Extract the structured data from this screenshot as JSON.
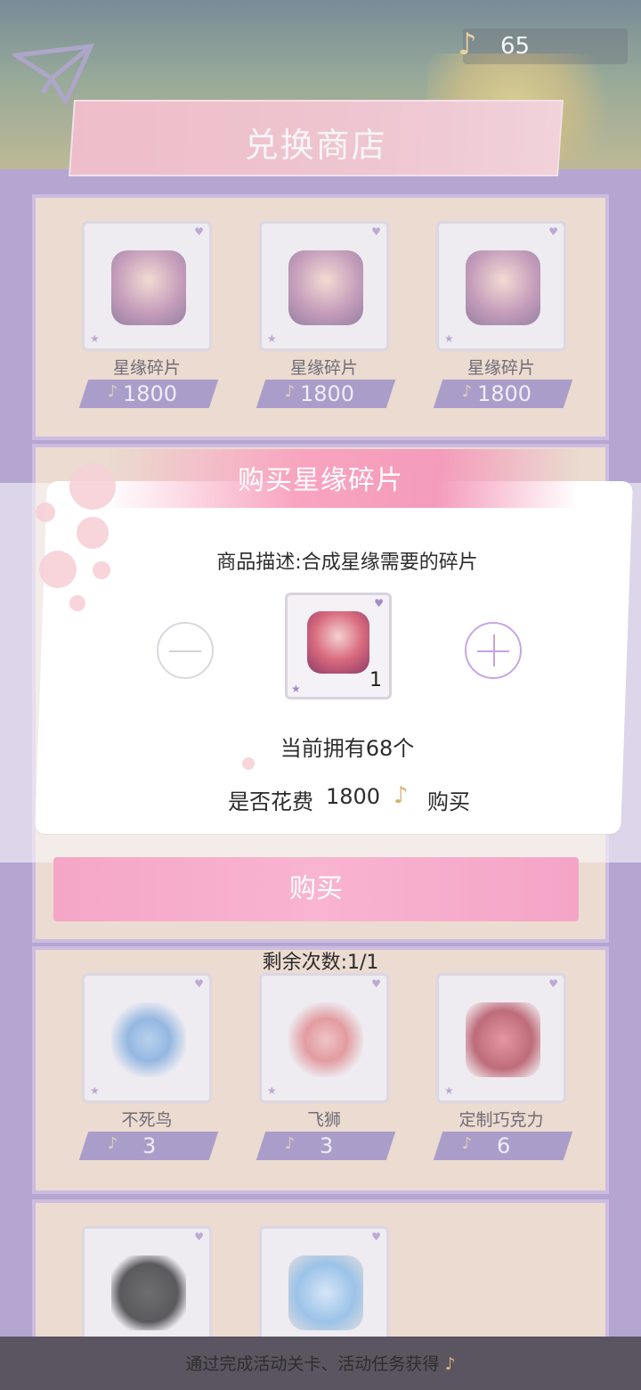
{
  "header": {
    "currency_value": "65",
    "currency_icon": "music-note-icon",
    "back_icon": "paper-plane-back-icon",
    "title": "兑换商店"
  },
  "shop": {
    "row1": [
      {
        "name": "星缘碎片",
        "price": "1800"
      },
      {
        "name": "星缘碎片",
        "price": "1800"
      },
      {
        "name": "星缘碎片",
        "price": "1800"
      }
    ],
    "row3": [
      {
        "name": "不死鸟",
        "price": "3"
      },
      {
        "name": "飞狮",
        "price": "3"
      },
      {
        "name": "定制巧克力",
        "price": "6"
      }
    ],
    "row4": [
      {
        "name": "",
        "price": ""
      },
      {
        "name": "",
        "price": ""
      }
    ]
  },
  "dialog": {
    "title": "购买星缘碎片",
    "description": "商品描述:合成星缘需要的碎片",
    "quantity": "1",
    "owned": "当前拥有68个",
    "cost_prefix": "是否花费",
    "cost_value": "1800",
    "cost_suffix": "购买",
    "buy_label": "购买",
    "remaining": "剩余次数:1/1"
  },
  "footer": {
    "hint": "通过完成活动关卡、活动任务获得"
  },
  "colors": {
    "accent_pink": "#f5a6c6",
    "panel_bg": "#eed8c2",
    "price_bar": "#8b79b9",
    "background": "#9a86c4"
  }
}
